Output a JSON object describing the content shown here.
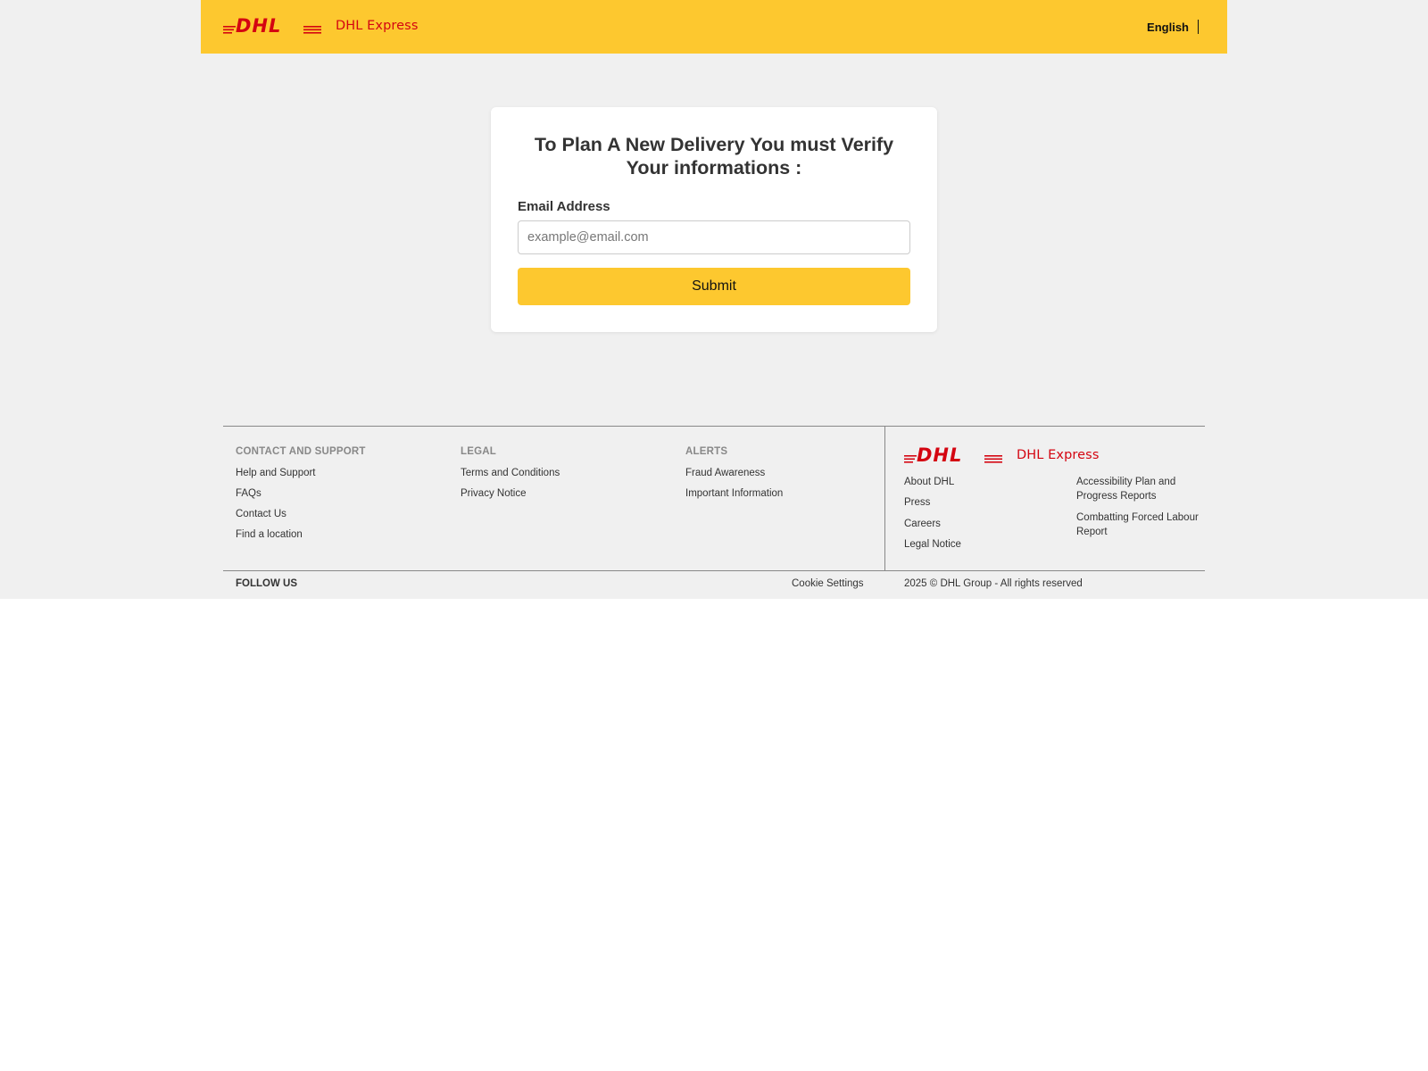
{
  "brand": {
    "name": "DHL Express",
    "color": "#d40511",
    "accent": "#fdc82f"
  },
  "header": {
    "language": "English",
    "logo_icon": "dhl-logo-icon"
  },
  "form": {
    "title": "To Plan A New Delivery You must Verify Your informations :",
    "email_label": "Email Address",
    "email_placeholder": "example@email.com",
    "email_value": "",
    "submit_label": "Submit"
  },
  "footer": {
    "columns": [
      {
        "heading": "CONTACT AND SUPPORT",
        "links": [
          "Help and Support",
          "FAQs",
          "Contact Us",
          "Find a location"
        ]
      },
      {
        "heading": "LEGAL",
        "links": [
          "Terms and Conditions",
          "Privacy Notice"
        ]
      },
      {
        "heading": "ALERTS",
        "links": [
          "Fraud Awareness",
          "Important Information"
        ]
      }
    ],
    "company_links_left": [
      "About DHL",
      "Press",
      "Careers",
      "Legal Notice"
    ],
    "company_links_right": [
      "Accessibility Plan and Progress Reports",
      "Combatting Forced Labour Report"
    ],
    "follow_us": "FOLLOW US",
    "cookie_settings": "Cookie Settings",
    "copyright": "2025 © DHL Group - All rights reserved"
  }
}
